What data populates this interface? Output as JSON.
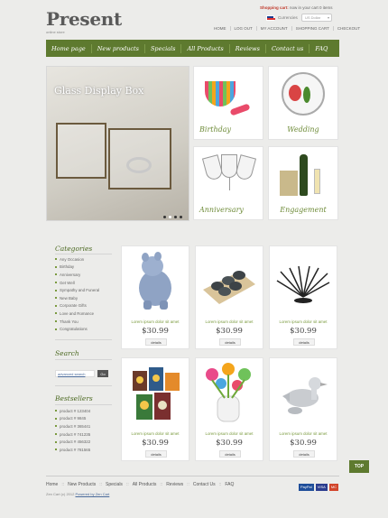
{
  "header": {
    "logo": "Present",
    "tagline": "online store",
    "cart_label": "Shopping cart:",
    "cart_text": "now in your cart 0 items",
    "currencies_label": "Currencies",
    "currency_selected": "US Dollar",
    "top_links": [
      "HOME",
      "LOG OUT",
      "MY ACCOUNT",
      "SHOPPING CART",
      "CHECKOUT"
    ]
  },
  "nav": [
    "Home page",
    "New products",
    "Specials",
    "All Products",
    "Reviews",
    "Contact us",
    "FAQ"
  ],
  "slider": {
    "title": "Glass Display Box",
    "slides": 4,
    "active_slide": 1
  },
  "tiles": [
    {
      "label": "Birthday"
    },
    {
      "label": "Wedding"
    },
    {
      "label": "Anniversary"
    },
    {
      "label": "Engagement"
    }
  ],
  "sidebar": {
    "categories_title": "Categories",
    "categories": [
      "Any Occasion",
      "Birthday",
      "Anniversary",
      "Get Well",
      "Sympathy and Funeral",
      "New Baby",
      "Corporate Gifts",
      "Love and Romance",
      "Thank You",
      "Congratulations"
    ],
    "search_title": "Search",
    "search_link": "advanced search",
    "search_button": "Go",
    "bestsellers_title": "Bestsellers",
    "bestsellers": [
      "product # 123404",
      "product # 9845",
      "product # 365441",
      "product # 741235",
      "product # 456322",
      "product # 781565"
    ]
  },
  "products": [
    {
      "name": "Lorem ipsum dolor sit amet",
      "price": "$30.99",
      "button": "details",
      "icon": "toy-hippo-icon"
    },
    {
      "name": "Lorem ipsum dolor sit amet",
      "price": "$30.99",
      "button": "details",
      "icon": "stone-tray-icon"
    },
    {
      "name": "Lorem ipsum dolor sit amet",
      "price": "$30.99",
      "button": "details",
      "icon": "wire-fruit-bowl-icon"
    },
    {
      "name": "Lorem ipsum dolor sit amet",
      "price": "$30.99",
      "button": "details",
      "icon": "candles-icon"
    },
    {
      "name": "Lorem ipsum dolor sit amet",
      "price": "$30.99",
      "button": "details",
      "icon": "flower-utensils-icon"
    },
    {
      "name": "Lorem ipsum dolor sit amet",
      "price": "$30.99",
      "button": "details",
      "icon": "bird-bottle-stopper-icon"
    }
  ],
  "footer": {
    "links": [
      "Home",
      "New Products",
      "Specials",
      "All Products",
      "Reviews",
      "Contact Us",
      "FAQ"
    ],
    "copyright": "Zen Cart (c) 2012",
    "powered": "Powered by Zen Cart",
    "top_button": "TOP",
    "payments": [
      "PayPal",
      "VISA",
      "MC"
    ]
  },
  "colors": {
    "brand_green": "#5e7a2f",
    "accent_red": "#c0392b"
  }
}
